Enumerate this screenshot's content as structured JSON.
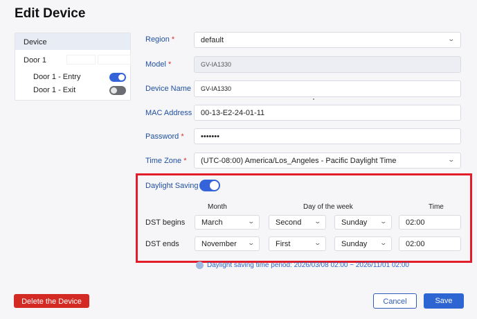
{
  "page": {
    "title": "Edit Device"
  },
  "device_panel": {
    "header": "Device",
    "door_label": "Door 1",
    "items": [
      {
        "label": "Door 1 - Entry",
        "enabled": true
      },
      {
        "label": "Door 1 - Exit",
        "enabled": false
      }
    ]
  },
  "form": {
    "region": {
      "label": "Region",
      "value": "default"
    },
    "model": {
      "label": "Model",
      "value": "GV-IA1330"
    },
    "device_name": {
      "label": "Device Name",
      "value": "GV-IA1330"
    },
    "mac_address": {
      "label": "MAC Address",
      "value": "00-13-E2-24-01-11"
    },
    "password": {
      "label": "Password",
      "value": "•••••••"
    },
    "time_zone": {
      "label": "Time Zone",
      "value": "(UTC-08:00) America/Los_Angeles - Pacific Daylight Time"
    },
    "required_mark": "*"
  },
  "daylight": {
    "label": "Daylight Saving",
    "enabled": true,
    "columns": {
      "month": "Month",
      "day_of_week": "Day of the week",
      "time": "Time"
    },
    "begins": {
      "label": "DST begins",
      "month": "March",
      "week": "Second",
      "day": "Sunday",
      "time": "02:00"
    },
    "ends": {
      "label": "DST ends",
      "month": "November",
      "week": "First",
      "day": "Sunday",
      "time": "02:00"
    },
    "period_text": "Daylight saving time period: 2026/03/08 02:00 ~ 2026/11/01 02:00"
  },
  "buttons": {
    "delete": "Delete the Device",
    "cancel": "Cancel",
    "save": "Save"
  },
  "colors": {
    "accent": "#2d65d3",
    "danger": "#d42a24",
    "highlight_box": "#e11d2a",
    "label": "#1f4f9f"
  }
}
